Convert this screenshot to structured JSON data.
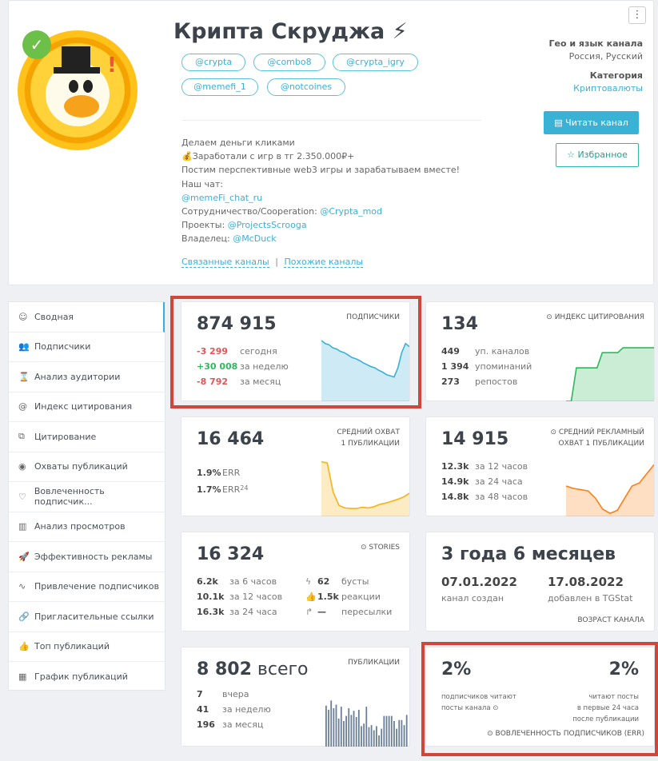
{
  "header": {
    "title": "Крипта Скруджа",
    "title_emoji": "⚡",
    "usernames": [
      "@crypta",
      "@combo8",
      "@crypta_igry",
      "@memefi_1",
      "@notcoines"
    ],
    "description": [
      {
        "text": "Делаем деньги кликами"
      },
      {
        "text": "💰Заработали с игр в тг 2.350.000₽+"
      },
      {
        "text": "Постим перспективные web3 игры и зарабатываем вместе!"
      },
      {
        "text": "Наш чат:"
      },
      {
        "prefix": "",
        "link": "@memeFi_chat_ru"
      },
      {
        "prefix": "Сотрудничество/Cooperation: ",
        "link": "@Crypta_mod"
      },
      {
        "prefix": "Проекты: ",
        "link": "@ProjectsScrooga"
      },
      {
        "prefix": "Владелец: ",
        "link": "@McDuck"
      }
    ],
    "related_link": "Связанные каналы",
    "similar_link": "Похожие каналы",
    "separator": "|",
    "geo_label": "Гео и язык канала",
    "geo_value": "Россия, Русский",
    "category_label": "Категория",
    "category_value": "Криптовалюты",
    "read_button": "Читать канал",
    "favorite_button": "Избранное",
    "menu_icon": "kebab-icon",
    "verified_icon": "check-badge-icon"
  },
  "sidebar": {
    "items": [
      {
        "label": "Сводная",
        "icon": "☺"
      },
      {
        "label": "Подписчики",
        "icon": "👥"
      },
      {
        "label": "Анализ аудитории",
        "icon": "⌛"
      },
      {
        "label": "Индекс цитирования",
        "icon": "@"
      },
      {
        "label": "Цитирование",
        "icon": "⧉"
      },
      {
        "label": "Охваты публикаций",
        "icon": "◉"
      },
      {
        "label": "Вовлеченность подписчик...",
        "icon": "♡"
      },
      {
        "label": "Анализ просмотров",
        "icon": "▥"
      },
      {
        "label": "Эффективность рекламы",
        "icon": "🚀"
      },
      {
        "label": "Привлечение подписчиков",
        "icon": "∿"
      },
      {
        "label": "Пригласительные ссылки",
        "icon": "🔗"
      },
      {
        "label": "Топ публикаций",
        "icon": "👍"
      },
      {
        "label": "График публикаций",
        "icon": "▦"
      }
    ]
  },
  "cards": {
    "subscribers": {
      "value": "874 915",
      "label": "ПОДПИСЧИКИ",
      "rows": [
        {
          "v": "-3 299",
          "t": "сегодня"
        },
        {
          "v": "+30 008",
          "t": "за неделю"
        },
        {
          "v": "-8 792",
          "t": "за месяц"
        }
      ],
      "colors": {
        "neg": "#e55353",
        "pos": "#2eb85c"
      }
    },
    "citation": {
      "value": "134",
      "label": "ИНДЕКС ЦИТИРОВАНИЯ",
      "rows": [
        {
          "v": "449",
          "t": "уп. каналов"
        },
        {
          "v": "1 394",
          "t": "упоминаний"
        },
        {
          "v": "273",
          "t": "репостов"
        }
      ]
    },
    "reach": {
      "value": "16 464",
      "label1": "СРЕДНИЙ ОХВАТ",
      "label2": "1 ПУБЛИКАЦИИ",
      "rows": [
        {
          "v": "1.9%",
          "t": "ERR"
        },
        {
          "v": "1.7%",
          "t": "ERR",
          "sub": "24"
        }
      ]
    },
    "ad_reach": {
      "value": "14 915",
      "label1": "СРЕДНИЙ РЕКЛАМНЫЙ",
      "label2": "ОХВАТ 1 ПУБЛИКАЦИИ",
      "rows": [
        {
          "v": "12.3k",
          "t": "за 12 часов"
        },
        {
          "v": "14.9k",
          "t": "за 24 часа"
        },
        {
          "v": "14.8k",
          "t": "за 48 часов"
        }
      ]
    },
    "stories": {
      "value": "16 324",
      "label": "STORIES",
      "rows": [
        {
          "v": "6.2k",
          "t": "за 6 часов"
        },
        {
          "v": "10.1k",
          "t": "за 12 часов"
        },
        {
          "v": "16.3k",
          "t": "за 24 часа"
        }
      ],
      "rows2": [
        {
          "icon": "ϟ",
          "v": "62",
          "t": "бусты"
        },
        {
          "icon": "👍",
          "v": "1.5k",
          "t": "реакции"
        },
        {
          "icon": "↱",
          "v": "—",
          "t": "пересылки"
        }
      ]
    },
    "age": {
      "value": "3 года 6 месяцев",
      "created": "07.01.2022",
      "created_label": "канал создан",
      "added": "17.08.2022",
      "added_label": "добавлен в TGStat",
      "label": "ВОЗРАСТ КАНАЛА"
    },
    "posts": {
      "value": "8 802",
      "value_suffix": "всего",
      "label": "ПУБЛИКАЦИИ",
      "rows": [
        {
          "v": "7",
          "t": "вчера"
        },
        {
          "v": "41",
          "t": "за неделю"
        },
        {
          "v": "196",
          "t": "за месяц"
        }
      ]
    },
    "err": {
      "value1": "2%",
      "text1a": "подписчиков читают",
      "text1b": "посты канала",
      "value2": "2%",
      "text2a": "читают посты",
      "text2b": "в первые 24 часа",
      "text2c": "после публикации",
      "label": "ВОВЛЕЧЕННОСТЬ ПОДПИСЧИКОВ (ERR)"
    }
  },
  "chart_data": [
    {
      "type": "area",
      "name": "subscribers",
      "color": "#3ab0d9",
      "values": [
        100,
        95,
        93,
        88,
        86,
        82,
        80,
        76,
        72,
        70,
        67,
        63,
        60,
        57,
        55,
        51,
        48,
        44,
        42,
        40,
        55,
        80,
        95,
        90
      ]
    },
    {
      "type": "area",
      "name": "citation",
      "color": "#2eb85c",
      "values": [
        0,
        0,
        55,
        55,
        55,
        55,
        55,
        80,
        80,
        80,
        80,
        88,
        88,
        88,
        88,
        88,
        88,
        88
      ]
    },
    {
      "type": "area",
      "name": "reach",
      "color": "#f9b115",
      "values": [
        90,
        88,
        40,
        18,
        14,
        13,
        13,
        15,
        14,
        16,
        20,
        22,
        25,
        28,
        32,
        38
      ]
    },
    {
      "type": "area",
      "name": "ad_reach",
      "color": "#fd7e14",
      "values": [
        50,
        46,
        44,
        42,
        30,
        12,
        5,
        10,
        30,
        50,
        55,
        70,
        85
      ]
    },
    {
      "type": "bar",
      "name": "posts",
      "color": "#6a7f96",
      "values": [
        80,
        72,
        90,
        75,
        82,
        55,
        78,
        50,
        60,
        75,
        62,
        70,
        58,
        72,
        40,
        45,
        78,
        38,
        42,
        32,
        40,
        22,
        35,
        60,
        60,
        60,
        60,
        50,
        35,
        52,
        52,
        42,
        62
      ]
    }
  ]
}
